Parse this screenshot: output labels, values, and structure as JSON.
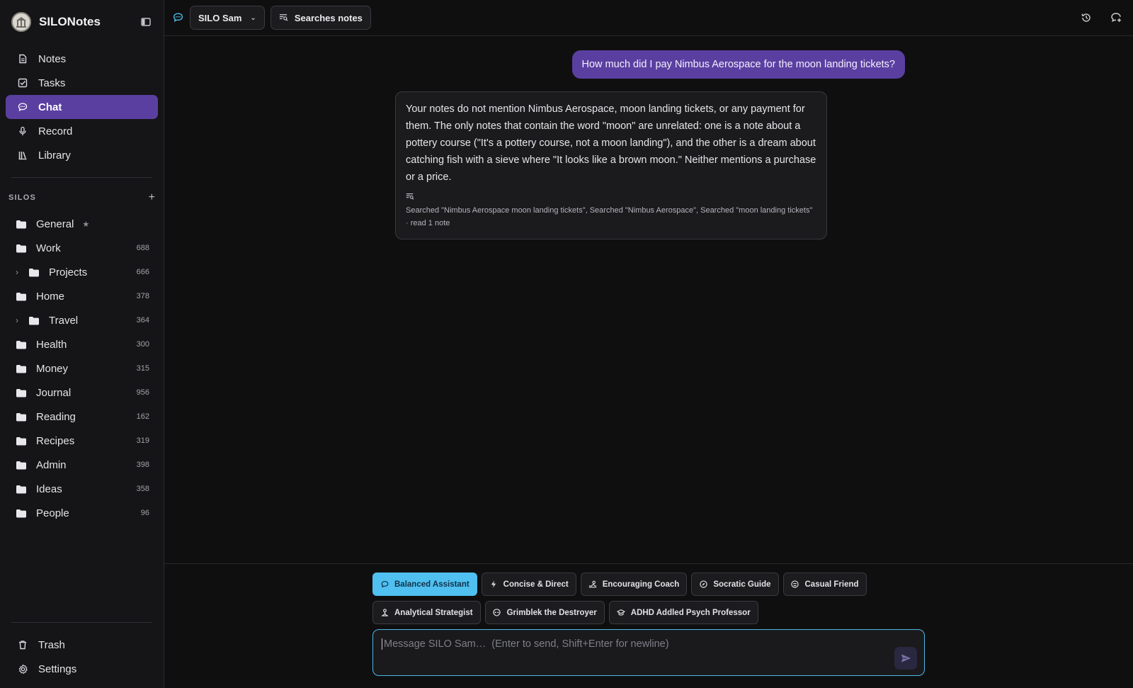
{
  "app": {
    "name": "SILONotes"
  },
  "nav": [
    {
      "id": "notes",
      "label": "Notes",
      "icon": "notes-icon"
    },
    {
      "id": "tasks",
      "label": "Tasks",
      "icon": "tasks-icon"
    },
    {
      "id": "chat",
      "label": "Chat",
      "icon": "chat-icon",
      "active": true
    },
    {
      "id": "record",
      "label": "Record",
      "icon": "microphone-icon"
    },
    {
      "id": "library",
      "label": "Library",
      "icon": "library-icon"
    }
  ],
  "silos": {
    "title": "SILOS",
    "add_label": "+",
    "items": [
      {
        "name": "General",
        "count": "",
        "star": "★"
      },
      {
        "name": "Work",
        "count": "688"
      },
      {
        "name": "Projects",
        "count": "666",
        "expandable": true
      },
      {
        "name": "Home",
        "count": "378"
      },
      {
        "name": "Travel",
        "count": "364",
        "expandable": true
      },
      {
        "name": "Health",
        "count": "300"
      },
      {
        "name": "Money",
        "count": "315"
      },
      {
        "name": "Journal",
        "count": "956"
      },
      {
        "name": "Reading",
        "count": "162"
      },
      {
        "name": "Recipes",
        "count": "319"
      },
      {
        "name": "Admin",
        "count": "398"
      },
      {
        "name": "Ideas",
        "count": "358"
      },
      {
        "name": "People",
        "count": "96"
      }
    ]
  },
  "bottom_nav": [
    {
      "label": "Trash",
      "icon": "trash-icon"
    },
    {
      "label": "Settings",
      "icon": "gear-icon"
    }
  ],
  "topbar": {
    "assistant_label": "SILO Sam",
    "mode_label": "Searches notes"
  },
  "chat": {
    "user_message": "How much did I pay Nimbus Aerospace for the moon landing tickets?",
    "assistant_message": "Your notes do not mention Nimbus Aerospace, moon landing tickets, or any payment for them. The only notes that contain the word \"moon\" are unrelated: one is a note about a pottery course (\"It's a pottery course, not a moon landing\"), and the other is a dream about catching fish with a sieve where \"It looks like a brown moon.\" Neither mentions a purchase or a price.",
    "tool_summary": "Searched \"Nimbus Aerospace moon landing tickets\", Searched \"Nimbus Aerospace\", Searched \"moon landing tickets\" · read 1 note"
  },
  "personas": [
    {
      "label": "Balanced Assistant",
      "icon": "chat-bubble-icon",
      "active": true
    },
    {
      "label": "Concise & Direct",
      "icon": "lightning-icon"
    },
    {
      "label": "Encouraging Coach",
      "icon": "coach-icon"
    },
    {
      "label": "Socratic Guide",
      "icon": "compass-icon"
    },
    {
      "label": "Casual Friend",
      "icon": "smile-icon"
    },
    {
      "label": "Analytical Strategist",
      "icon": "strategy-icon"
    },
    {
      "label": "Grimblek the Destroyer",
      "icon": "alien-icon"
    },
    {
      "label": "ADHD Addled Psych Professor",
      "icon": "graduation-cap-icon"
    }
  ],
  "composer": {
    "placeholder": "Message SILO Sam…  (Enter to send, Shift+Enter for newline)"
  },
  "colors": {
    "accent": "#5b3fa0",
    "persona_active": "#4fc0f0",
    "input_border": "#4fb8e6"
  }
}
